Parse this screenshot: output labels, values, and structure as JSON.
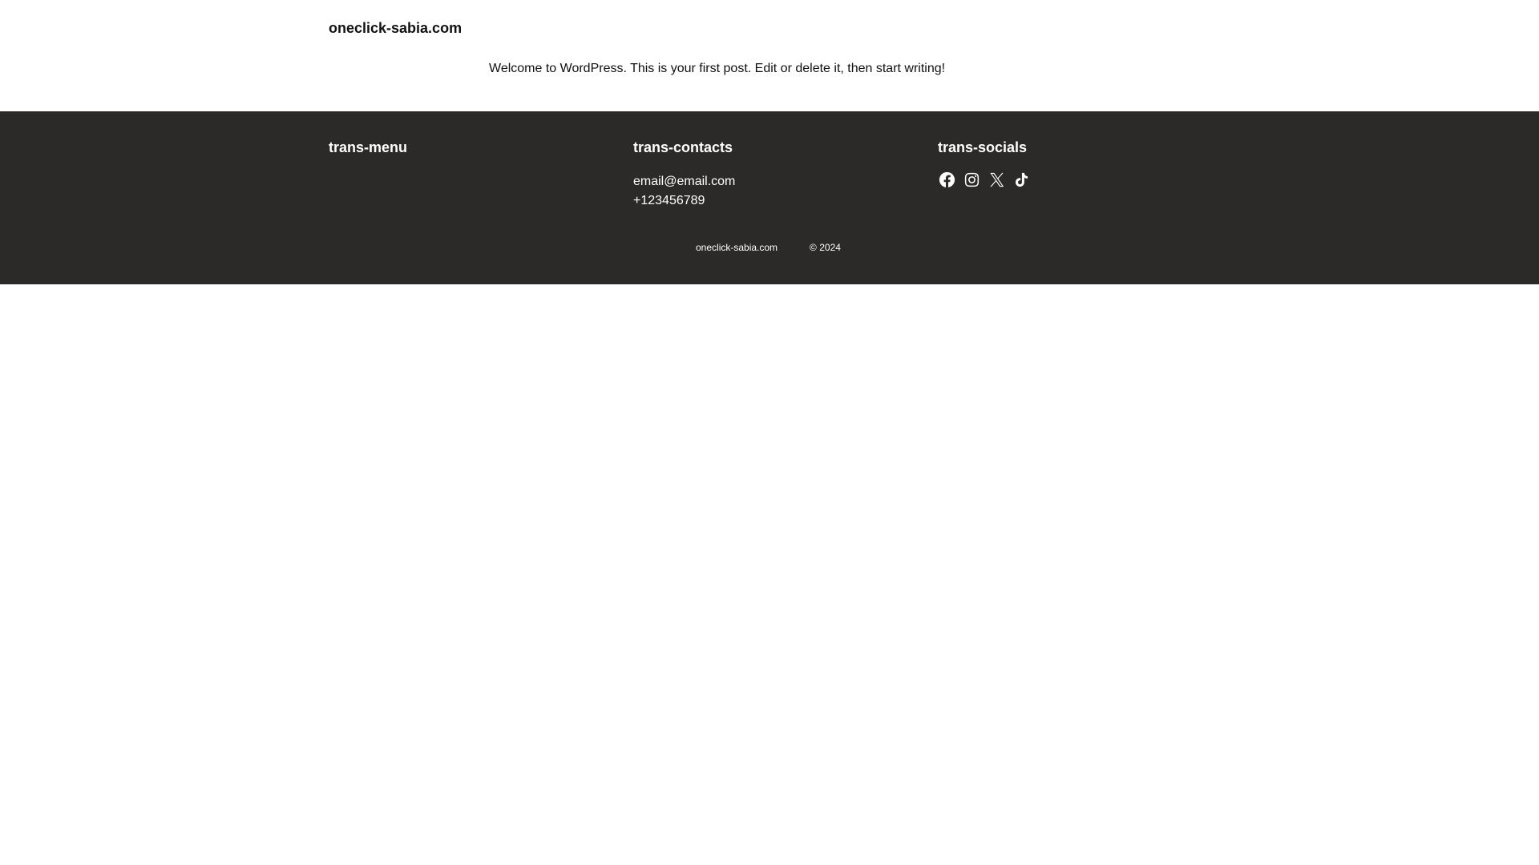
{
  "header": {
    "site_title": "oneclick-sabia.com"
  },
  "main": {
    "post_text": "Welcome to WordPress. This is your first post. Edit or delete it, then start writing!"
  },
  "footer": {
    "menu": {
      "heading": "trans-menu"
    },
    "contacts": {
      "heading": "trans-contacts",
      "email": "email@email.com",
      "phone": "+123456789"
    },
    "socials": {
      "heading": "trans-socials",
      "icons": [
        "facebook-icon",
        "instagram-icon",
        "x-icon",
        "tiktok-icon"
      ]
    },
    "bottom": {
      "site_name": "oneclick-sabia.com",
      "copyright": "© 2024"
    }
  },
  "colors": {
    "footer_bg": "#2b2a28",
    "text_dark": "#111111",
    "text_light": "#ffffff"
  }
}
